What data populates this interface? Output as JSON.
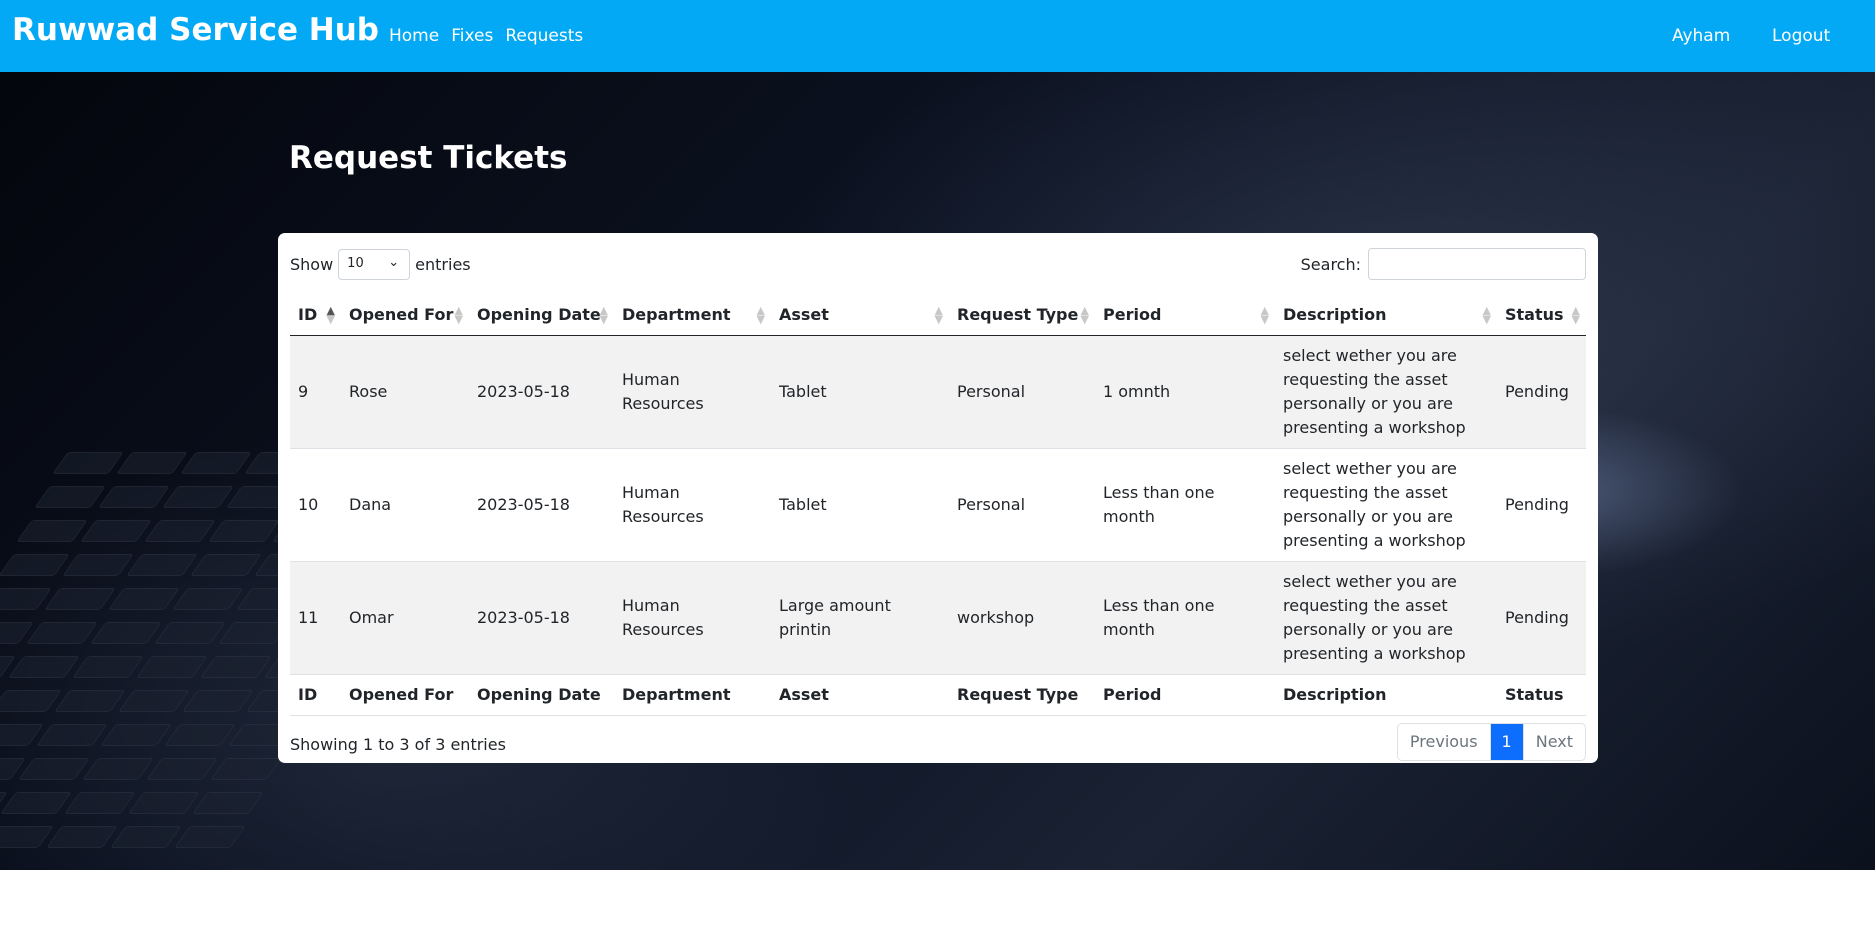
{
  "nav": {
    "brand": "Ruwwad Service Hub",
    "links": [
      "Home",
      "Fixes",
      "Requests"
    ],
    "user": "Ayham",
    "logout": "Logout",
    "color": "#03a9f4"
  },
  "page": {
    "title": "Request Tickets"
  },
  "table_controls": {
    "show_label": "Show",
    "entries_value": "10",
    "entries_label": "entries",
    "search_label": "Search:",
    "search_value": ""
  },
  "columns": [
    "ID",
    "Opened For",
    "Opening Date",
    "Department",
    "Asset",
    "Request Type",
    "Period",
    "Description",
    "Status"
  ],
  "rows": [
    {
      "id": "9",
      "opened_for": "Rose",
      "opening_date": "2023-05-18",
      "department": "Human Resources",
      "asset": "Tablet",
      "request_type": "Personal",
      "period": "1 omnth",
      "description": "select wether you are requesting the asset personally or you are presenting a workshop",
      "status": "Pending"
    },
    {
      "id": "10",
      "opened_for": "Dana",
      "opening_date": "2023-05-18",
      "department": "Human Resources",
      "asset": "Tablet",
      "request_type": "Personal",
      "period": "Less than one month",
      "description": "select wether you are requesting the asset personally or you are presenting a workshop",
      "status": "Pending"
    },
    {
      "id": "11",
      "opened_for": "Omar",
      "opening_date": "2023-05-18",
      "department": "Human Resources",
      "asset": "Large amount printin",
      "request_type": "workshop",
      "period": "Less than one month",
      "description": "select wether you are requesting the asset personally or you are presenting a workshop",
      "status": "Pending"
    }
  ],
  "footer": {
    "info": "Showing 1 to 3 of 3 entries",
    "previous": "Previous",
    "current_page": "1",
    "next": "Next",
    "accent": "#0d6efd"
  }
}
